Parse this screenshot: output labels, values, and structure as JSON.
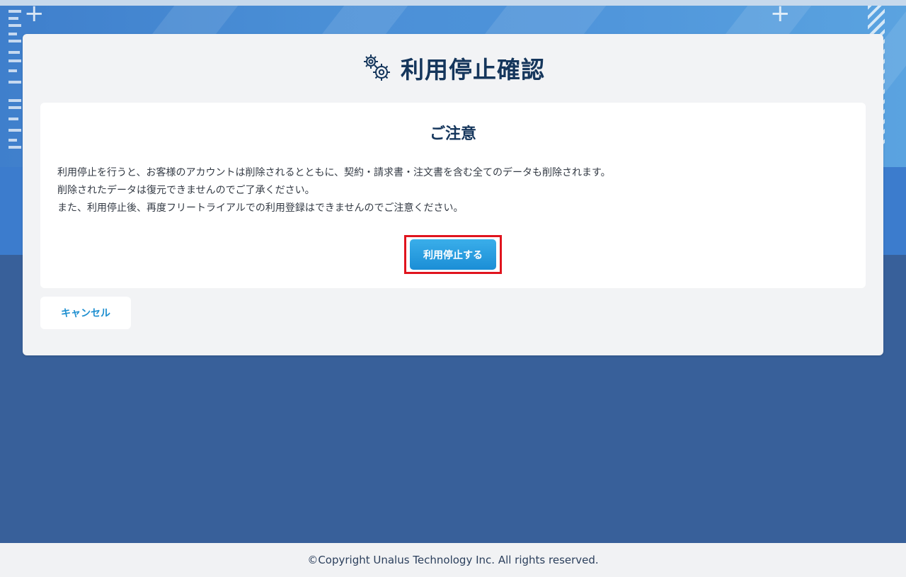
{
  "page": {
    "title": "利用停止確認",
    "icon": "gears-icon"
  },
  "notice": {
    "title": "ご注意",
    "lines": [
      "利用停止を行うと、お客様のアカウントは削除されるとともに、契約・請求書・注文書を含む全てのデータも削除されます。",
      "削除されたデータは復元できませんのでご了承ください。",
      "また、利用停止後、再度フリートライアルでの利用登録はできませんのでご注意ください。"
    ]
  },
  "actions": {
    "confirm_label": "利用停止する",
    "cancel_label": "キャンセル"
  },
  "footer": {
    "copyright": "©Copyright Unalus Technology Inc. All rights reserved."
  },
  "colors": {
    "background": "#38609a",
    "title": "#15365c",
    "primary_button": "#1b8ed6",
    "highlight_frame": "#e0141e",
    "cancel_text": "#1e8fd0"
  }
}
